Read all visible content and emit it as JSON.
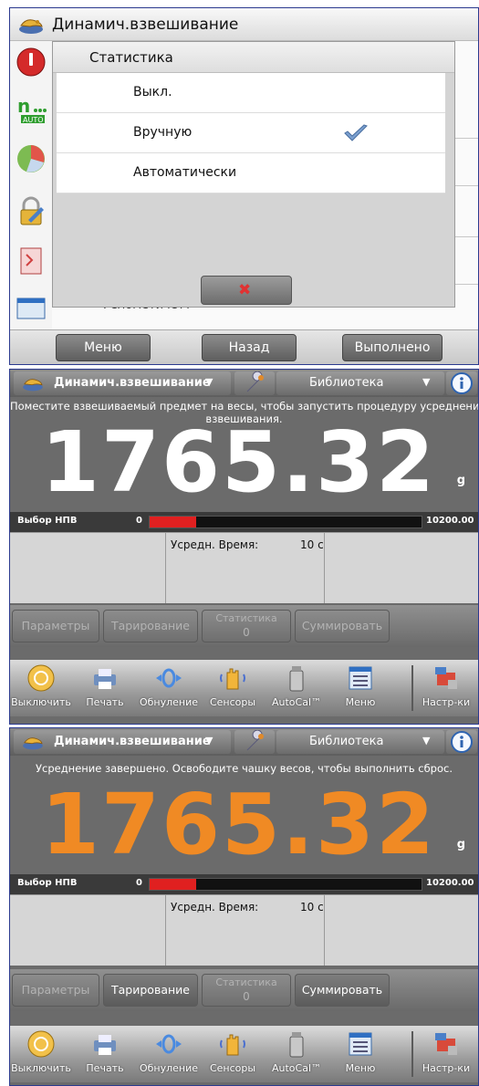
{
  "settings_screen": {
    "title": "Динамич.взвешивание",
    "dialog": {
      "title": "Статистика",
      "options": [
        {
          "label": "Выкл.",
          "selected": false
        },
        {
          "label": "Вручную",
          "selected": true
        },
        {
          "label": "Автоматически",
          "selected": false
        }
      ]
    },
    "footer": {
      "menu": "Меню",
      "back": "Назад",
      "done": "Выполнено"
    },
    "underlying_row_text": "Гелометичетт"
  },
  "weigh_screens": [
    {
      "app_name": "Динамич.взвешивание",
      "library_label": "Библиотека",
      "message": "Поместите взвешиваемый предмет на весы, чтобы запустить процедуру усреднения взвешивания.",
      "message_line1": "Поместите взвешиваемый предмет на весы, чтобы запустить процедуру усреднения",
      "message_line2": "взвешивания.",
      "reading": "1765.32",
      "reading_color": "#ffffff",
      "unit": "g",
      "capacity_label": "Выбор НПВ",
      "capacity_min": "0",
      "capacity_max": "10200.00",
      "capacity_fraction": 0.17,
      "avg_time_label": "Усредн. Время:",
      "avg_time_value": "10 с",
      "softkeys": {
        "params": "Параметры",
        "tare": "Тарирование",
        "stats": "Статистика",
        "stats_count": "0",
        "accumulate": "Суммировать",
        "tare_enabled": false,
        "accumulate_enabled": false
      },
      "icons": {
        "off": "Выключить",
        "print": "Печать",
        "zero": "Обнуление",
        "sensors": "Сенсоры",
        "autocal": "AutoCal™",
        "menu": "Меню",
        "setup": "Настр-ки"
      }
    },
    {
      "app_name": "Динамич.взвешивание",
      "library_label": "Библиотека",
      "message": "Усреднение завершено.  Освободите чашку весов, чтобы выполнить сброс.",
      "message_line1": "Усреднение завершено.  Освободите чашку весов, чтобы выполнить сброс.",
      "message_line2": "",
      "reading": "1765.32",
      "reading_color": "#f08a24",
      "unit": "g",
      "capacity_label": "Выбор НПВ",
      "capacity_min": "0",
      "capacity_max": "10200.00",
      "capacity_fraction": 0.17,
      "avg_time_label": "Усредн. Время:",
      "avg_time_value": "10 с",
      "softkeys": {
        "params": "Параметры",
        "tare": "Тарирование",
        "stats": "Статистика",
        "stats_count": "0",
        "accumulate": "Суммировать",
        "tare_enabled": true,
        "accumulate_enabled": true
      },
      "icons": {
        "off": "Выключить",
        "print": "Печать",
        "zero": "Обнуление",
        "sensors": "Сенсоры",
        "autocal": "AutoCal™",
        "menu": "Меню",
        "setup": "Настр-ки"
      }
    }
  ]
}
